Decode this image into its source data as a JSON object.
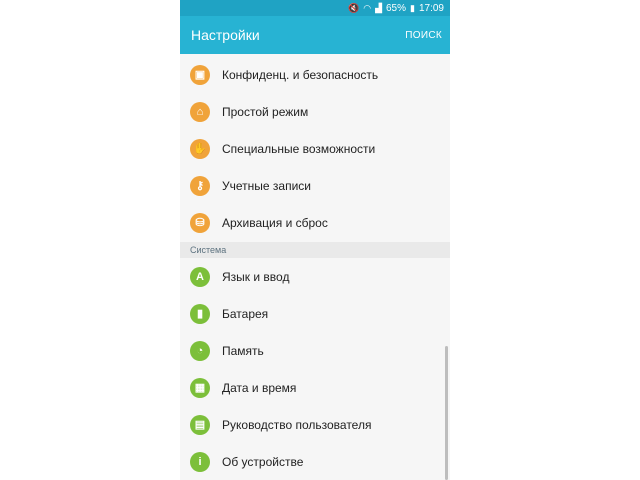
{
  "status_bar": {
    "battery": "65%",
    "time": "17:09",
    "icons": [
      "mute-icon",
      "wifi-icon",
      "signal-icon",
      "battery-icon"
    ]
  },
  "app_bar": {
    "title": "Настройки",
    "search_label": "ПОИСК"
  },
  "personal_items": [
    {
      "label": "Конфиденц. и безопасность",
      "icon": "lock-icon",
      "glyph": "▣"
    },
    {
      "label": "Простой режим",
      "icon": "home-icon",
      "glyph": "⌂"
    },
    {
      "label": "Специальные возможности",
      "icon": "hand-icon",
      "glyph": "✋"
    },
    {
      "label": "Учетные записи",
      "icon": "key-icon",
      "glyph": "⚷"
    },
    {
      "label": "Архивация и сброс",
      "icon": "backup-icon",
      "glyph": "⛁"
    }
  ],
  "system_section": {
    "header": "Система",
    "items": [
      {
        "label": "Язык и ввод",
        "icon": "language-icon",
        "glyph": "A"
      },
      {
        "label": "Батарея",
        "icon": "battery-icon",
        "glyph": "▮"
      },
      {
        "label": "Память",
        "icon": "storage-icon",
        "glyph": "◔"
      },
      {
        "label": "Дата и время",
        "icon": "calendar-icon",
        "glyph": "▦"
      },
      {
        "label": "Руководство пользователя",
        "icon": "manual-icon",
        "glyph": "▤"
      },
      {
        "label": "Об устройстве",
        "icon": "info-icon",
        "glyph": "i"
      }
    ]
  },
  "colors": {
    "app_bar": "#27b3d3",
    "status_bar": "#1fa3c4",
    "personal_icon": "#f0a33a",
    "system_icon": "#7cbf3a"
  }
}
